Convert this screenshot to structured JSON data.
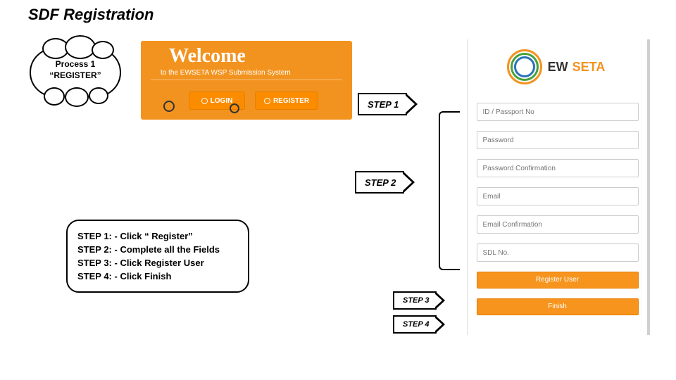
{
  "title": "SDF Registration",
  "cloud": {
    "line1": "Process 1",
    "line2": "“REGISTER”"
  },
  "banner": {
    "heading": "Welcome",
    "subtitle": "to the EWSETA WSP Submission System",
    "login_label": "LOGIN",
    "register_label": "REGISTER"
  },
  "step_labels": {
    "s1": "STEP 1",
    "s2": "STEP 2",
    "s3": "STEP 3",
    "s4": "STEP 4"
  },
  "steps_box": {
    "s1": "STEP 1: - Click “ Register”",
    "s2": "STEP 2: - Complete all the Fields",
    "s3": "STEP 3: - Click Register User",
    "s4": "STEP 4: - Click Finish"
  },
  "logo": {
    "ew": "EW",
    "seta": "SETA"
  },
  "form": {
    "id_placeholder": "ID / Passport No",
    "pwd_placeholder": "Password",
    "pwd2_placeholder": "Password Confirmation",
    "email_placeholder": "Email",
    "email2_placeholder": "Email Confirmation",
    "sdl_placeholder": "SDL No.",
    "register_user_label": "Register User",
    "finish_label": "Finish"
  }
}
